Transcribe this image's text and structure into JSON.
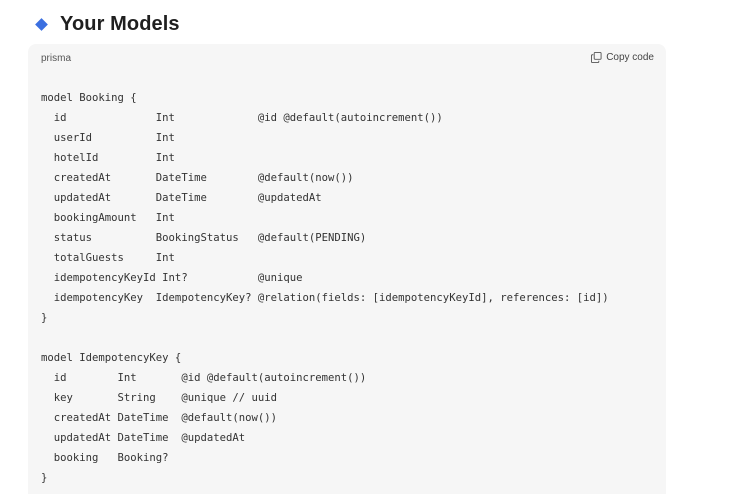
{
  "heading": {
    "title": "Your Models",
    "bullet_color": "#3b6fe0"
  },
  "code_block": {
    "language": "prisma",
    "copy_label": "Copy code",
    "copy_icon": "copy-icon",
    "lines": [
      "model Booking {",
      "  id              Int             @id @default(autoincrement())",
      "  userId          Int",
      "  hotelId         Int",
      "  createdAt       DateTime        @default(now())",
      "  updatedAt       DateTime        @updatedAt",
      "  bookingAmount   Int",
      "  status          BookingStatus   @default(PENDING)",
      "  totalGuests     Int",
      "  idempotencyKeyId Int?           @unique",
      "  idempotencyKey  IdempotencyKey? @relation(fields: [idempotencyKeyId], references: [id])",
      "}",
      "",
      "model IdempotencyKey {",
      "  id        Int       @id @default(autoincrement())",
      "  key       String    @unique // uuid",
      "  createdAt DateTime  @default(now())",
      "  updatedAt DateTime  @updatedAt",
      "  booking   Booking?",
      "}"
    ]
  }
}
